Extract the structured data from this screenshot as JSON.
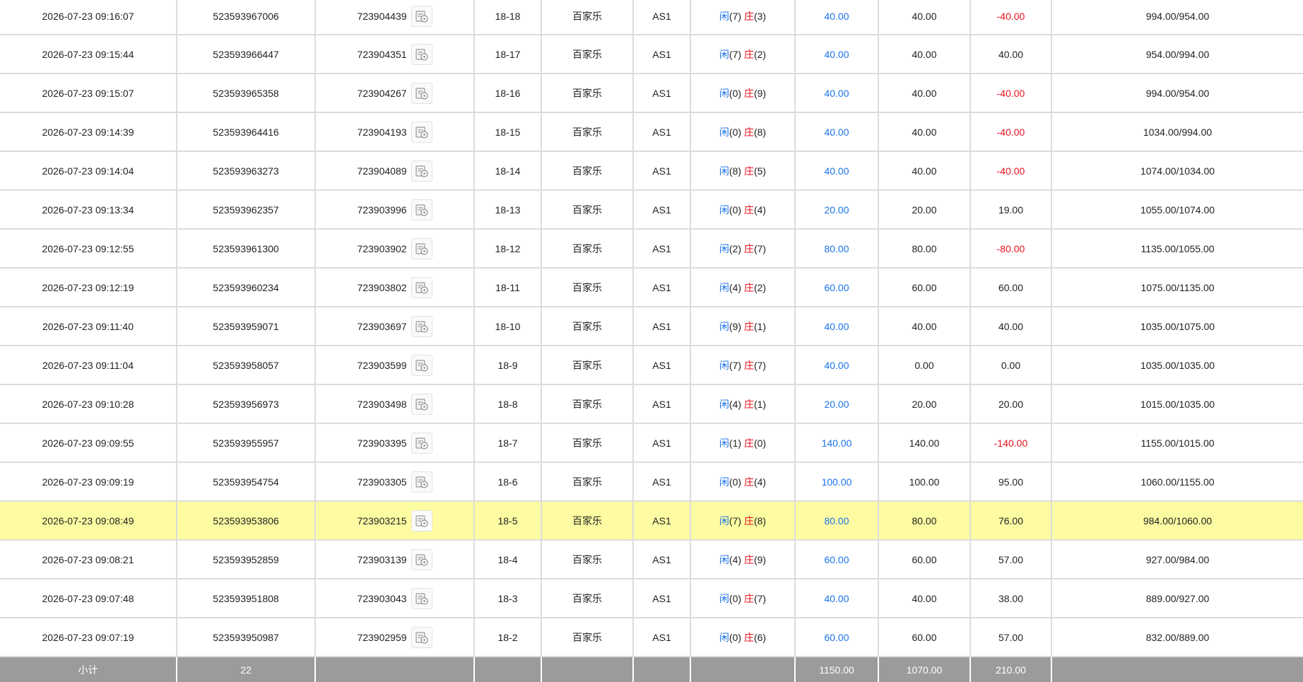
{
  "game_type_label": "百家乐",
  "table_code": "AS1",
  "result_labels": {
    "player": "闲",
    "banker": "庄"
  },
  "rows": [
    {
      "time": "2026-07-23 09:16:07",
      "bet_id": "523593967006",
      "round_id": "723904439",
      "shoe": "18-18",
      "player": "7",
      "banker": "3",
      "bet": "40.00",
      "valid": "40.00",
      "win": "-40.00",
      "win_negative": true,
      "balance": "994.00/954.00"
    },
    {
      "time": "2026-07-23 09:15:44",
      "bet_id": "523593966447",
      "round_id": "723904351",
      "shoe": "18-17",
      "player": "7",
      "banker": "2",
      "bet": "40.00",
      "valid": "40.00",
      "win": "40.00",
      "win_negative": false,
      "balance": "954.00/994.00"
    },
    {
      "time": "2026-07-23 09:15:07",
      "bet_id": "523593965358",
      "round_id": "723904267",
      "shoe": "18-16",
      "player": "0",
      "banker": "9",
      "bet": "40.00",
      "valid": "40.00",
      "win": "-40.00",
      "win_negative": true,
      "balance": "994.00/954.00"
    },
    {
      "time": "2026-07-23 09:14:39",
      "bet_id": "523593964416",
      "round_id": "723904193",
      "shoe": "18-15",
      "player": "0",
      "banker": "8",
      "bet": "40.00",
      "valid": "40.00",
      "win": "-40.00",
      "win_negative": true,
      "balance": "1034.00/994.00"
    },
    {
      "time": "2026-07-23 09:14:04",
      "bet_id": "523593963273",
      "round_id": "723904089",
      "shoe": "18-14",
      "player": "8",
      "banker": "5",
      "bet": "40.00",
      "valid": "40.00",
      "win": "-40.00",
      "win_negative": true,
      "balance": "1074.00/1034.00"
    },
    {
      "time": "2026-07-23 09:13:34",
      "bet_id": "523593962357",
      "round_id": "723903996",
      "shoe": "18-13",
      "player": "0",
      "banker": "4",
      "bet": "20.00",
      "valid": "20.00",
      "win": "19.00",
      "win_negative": false,
      "balance": "1055.00/1074.00"
    },
    {
      "time": "2026-07-23 09:12:55",
      "bet_id": "523593961300",
      "round_id": "723903902",
      "shoe": "18-12",
      "player": "2",
      "banker": "7",
      "bet": "80.00",
      "valid": "80.00",
      "win": "-80.00",
      "win_negative": true,
      "balance": "1135.00/1055.00"
    },
    {
      "time": "2026-07-23 09:12:19",
      "bet_id": "523593960234",
      "round_id": "723903802",
      "shoe": "18-11",
      "player": "4",
      "banker": "2",
      "bet": "60.00",
      "valid": "60.00",
      "win": "60.00",
      "win_negative": false,
      "balance": "1075.00/1135.00"
    },
    {
      "time": "2026-07-23 09:11:40",
      "bet_id": "523593959071",
      "round_id": "723903697",
      "shoe": "18-10",
      "player": "9",
      "banker": "1",
      "bet": "40.00",
      "valid": "40.00",
      "win": "40.00",
      "win_negative": false,
      "balance": "1035.00/1075.00"
    },
    {
      "time": "2026-07-23 09:11:04",
      "bet_id": "523593958057",
      "round_id": "723903599",
      "shoe": "18-9",
      "player": "7",
      "banker": "7",
      "bet": "40.00",
      "valid": "0.00",
      "win": "0.00",
      "win_negative": false,
      "balance": "1035.00/1035.00"
    },
    {
      "time": "2026-07-23 09:10:28",
      "bet_id": "523593956973",
      "round_id": "723903498",
      "shoe": "18-8",
      "player": "4",
      "banker": "1",
      "bet": "20.00",
      "valid": "20.00",
      "win": "20.00",
      "win_negative": false,
      "balance": "1015.00/1035.00"
    },
    {
      "time": "2026-07-23 09:09:55",
      "bet_id": "523593955957",
      "round_id": "723903395",
      "shoe": "18-7",
      "player": "1",
      "banker": "0",
      "bet": "140.00",
      "valid": "140.00",
      "win": "-140.00",
      "win_negative": true,
      "balance": "1155.00/1015.00"
    },
    {
      "time": "2026-07-23 09:09:19",
      "bet_id": "523593954754",
      "round_id": "723903305",
      "shoe": "18-6",
      "player": "0",
      "banker": "4",
      "bet": "100.00",
      "valid": "100.00",
      "win": "95.00",
      "win_negative": false,
      "balance": "1060.00/1155.00"
    },
    {
      "time": "2026-07-23 09:08:49",
      "bet_id": "523593953806",
      "round_id": "723903215",
      "shoe": "18-5",
      "player": "7",
      "banker": "8",
      "bet": "80.00",
      "valid": "80.00",
      "win": "76.00",
      "win_negative": false,
      "balance": "984.00/1060.00",
      "highlight": true
    },
    {
      "time": "2026-07-23 09:08:21",
      "bet_id": "523593952859",
      "round_id": "723903139",
      "shoe": "18-4",
      "player": "4",
      "banker": "9",
      "bet": "60.00",
      "valid": "60.00",
      "win": "57.00",
      "win_negative": false,
      "balance": "927.00/984.00"
    },
    {
      "time": "2026-07-23 09:07:48",
      "bet_id": "523593951808",
      "round_id": "723903043",
      "shoe": "18-3",
      "player": "0",
      "banker": "7",
      "bet": "40.00",
      "valid": "40.00",
      "win": "38.00",
      "win_negative": false,
      "balance": "889.00/927.00"
    },
    {
      "time": "2026-07-23 09:07:19",
      "bet_id": "523593950987",
      "round_id": "723902959",
      "shoe": "18-2",
      "player": "0",
      "banker": "6",
      "bet": "60.00",
      "valid": "60.00",
      "win": "57.00",
      "win_negative": false,
      "balance": "832.00/889.00"
    }
  ],
  "subtotal": {
    "label": "小计",
    "count": "22",
    "bet": "1150.00",
    "valid": "1070.00",
    "win": "210.00"
  },
  "colors": {
    "blue": "#1a73e8",
    "red": "#e8111b",
    "highlight_row": "#fefca2",
    "subtotal_bg": "#9b9b9b",
    "border": "#dcdcdc"
  },
  "icons": {
    "transaction_button": "replay-detail-icon"
  }
}
